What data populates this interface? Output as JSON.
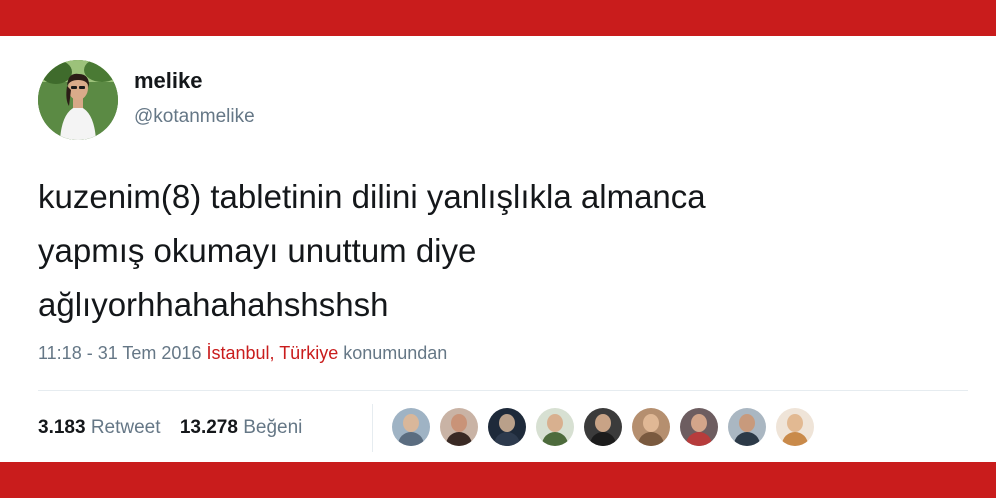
{
  "tweet": {
    "author": {
      "display_name": "melike",
      "handle": "@kotanmelike",
      "avatar_icon": "profile-photo"
    },
    "text_lines": [
      "kuzenim(8) tabletinin dilini yanlışlıkla almanca",
      "yapmış okumayı unuttum diye",
      "ağlıyorhhahahahshshsh"
    ],
    "meta": {
      "time_date": "11:18 - 31 Tem 2016",
      "location": "İstanbul, Türkiye",
      "location_suffix": "konumundan"
    },
    "stats": {
      "retweets_count": "3.183",
      "retweets_label": "Retweet",
      "likes_count": "13.278",
      "likes_label": "Beğeni"
    },
    "likers": [
      {
        "icon": "liker-avatar",
        "bg": "#9fb3c4",
        "skin": "#d9b79a",
        "shirt": "#5b6d80"
      },
      {
        "icon": "liker-avatar",
        "bg": "#c9b3a5",
        "skin": "#c99378",
        "shirt": "#3a2a25"
      },
      {
        "icon": "liker-avatar",
        "bg": "#1e2a3a",
        "skin": "#b9a08a",
        "shirt": "#2d3a4d"
      },
      {
        "icon": "liker-avatar",
        "bg": "#d7e0d2",
        "skin": "#d8b08f",
        "shirt": "#4d6b3c"
      },
      {
        "icon": "liker-avatar",
        "bg": "#3b3b3b",
        "skin": "#c8a386",
        "shirt": "#1c1c1c"
      },
      {
        "icon": "liker-avatar",
        "bg": "#b58f6f",
        "skin": "#e0b895",
        "shirt": "#7a5a3f"
      },
      {
        "icon": "liker-avatar",
        "bg": "#6d5d60",
        "skin": "#d3a58a",
        "shirt": "#b73c3c"
      },
      {
        "icon": "liker-avatar",
        "bg": "#aab7c2",
        "skin": "#c89a7c",
        "shirt": "#2c3a48"
      },
      {
        "icon": "liker-avatar",
        "bg": "#efe4d8",
        "skin": "#e2b992",
        "shirt": "#c98a4a"
      }
    ]
  },
  "colors": {
    "brand_band": "#c91c1c",
    "location_link": "#c91c1c",
    "muted_text": "#657786",
    "primary_text": "#14171a"
  }
}
